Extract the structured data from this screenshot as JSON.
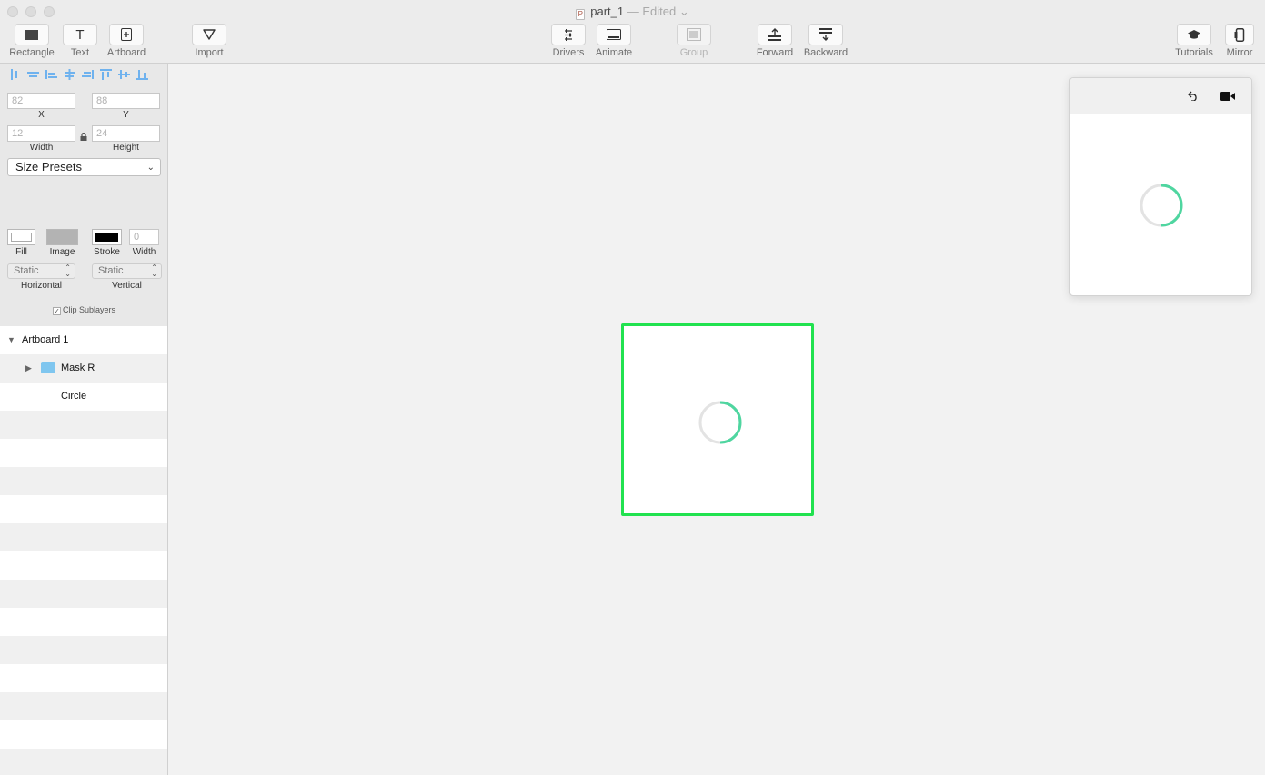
{
  "window": {
    "title": "part_1",
    "edited_suffix": "— Edited",
    "doc_icon_glyph": "P"
  },
  "toolbar": {
    "rectangle": "Rectangle",
    "text": "Text",
    "artboard": "Artboard",
    "import": "Import",
    "drivers": "Drivers",
    "animate": "Animate",
    "group": "Group",
    "forward": "Forward",
    "backward": "Backward",
    "tutorials": "Tutorials",
    "mirror": "Mirror"
  },
  "inspector": {
    "x": {
      "value": "82",
      "label": "X"
    },
    "y": {
      "value": "88",
      "label": "Y"
    },
    "width": {
      "value": "12",
      "label": "Width"
    },
    "height": {
      "value": "24",
      "label": "Height"
    },
    "size_presets": "Size Presets",
    "fill_label": "Fill",
    "image_label": "Image",
    "stroke_label": "Stroke",
    "stroke_width": {
      "value": "0",
      "label": "Width"
    },
    "horizontal": {
      "value": "Static",
      "label": "Horizontal"
    },
    "vertical": {
      "value": "Static",
      "label": "Vertical"
    },
    "clip_sublayers": "Clip Sublayers"
  },
  "layers": [
    {
      "name": "Artboard 1",
      "expanded": true
    },
    {
      "name": "Mask R",
      "expanded": false,
      "folder": true
    },
    {
      "name": "Circle"
    }
  ],
  "colors": {
    "artboard_border": "#21e24f",
    "spinner_accent": "#4fd6a0",
    "spinner_track": "#e3e3e3",
    "align_icons": "#6fb2ee"
  }
}
